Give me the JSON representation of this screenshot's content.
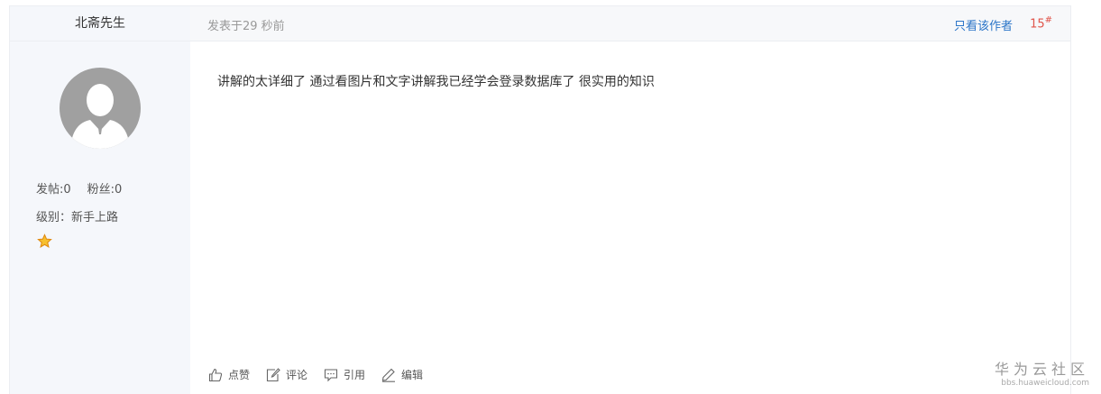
{
  "user": {
    "name": "北斋先生",
    "posts_label": "发帖:0",
    "fans_label": "粉丝:0",
    "level_label": "级别：新手上路",
    "star_icon": "star-icon"
  },
  "post": {
    "time": "发表于29 秒前",
    "only_author": "只看该作者",
    "floor_number": "15",
    "floor_mark": "#",
    "body": "讲解的太详细了 通过看图片和文字讲解我已经学会登录数据库了 很实用的知识"
  },
  "actions": {
    "like": "点赞",
    "comment": "评论",
    "quote": "引用",
    "edit": "编辑"
  },
  "watermark": {
    "brand": "华为云社区",
    "url": "bbs.huaweicloud.com"
  },
  "colors": {
    "link": "#2b75c8",
    "floor": "#e0544a",
    "panel": "#f5f7fb"
  }
}
